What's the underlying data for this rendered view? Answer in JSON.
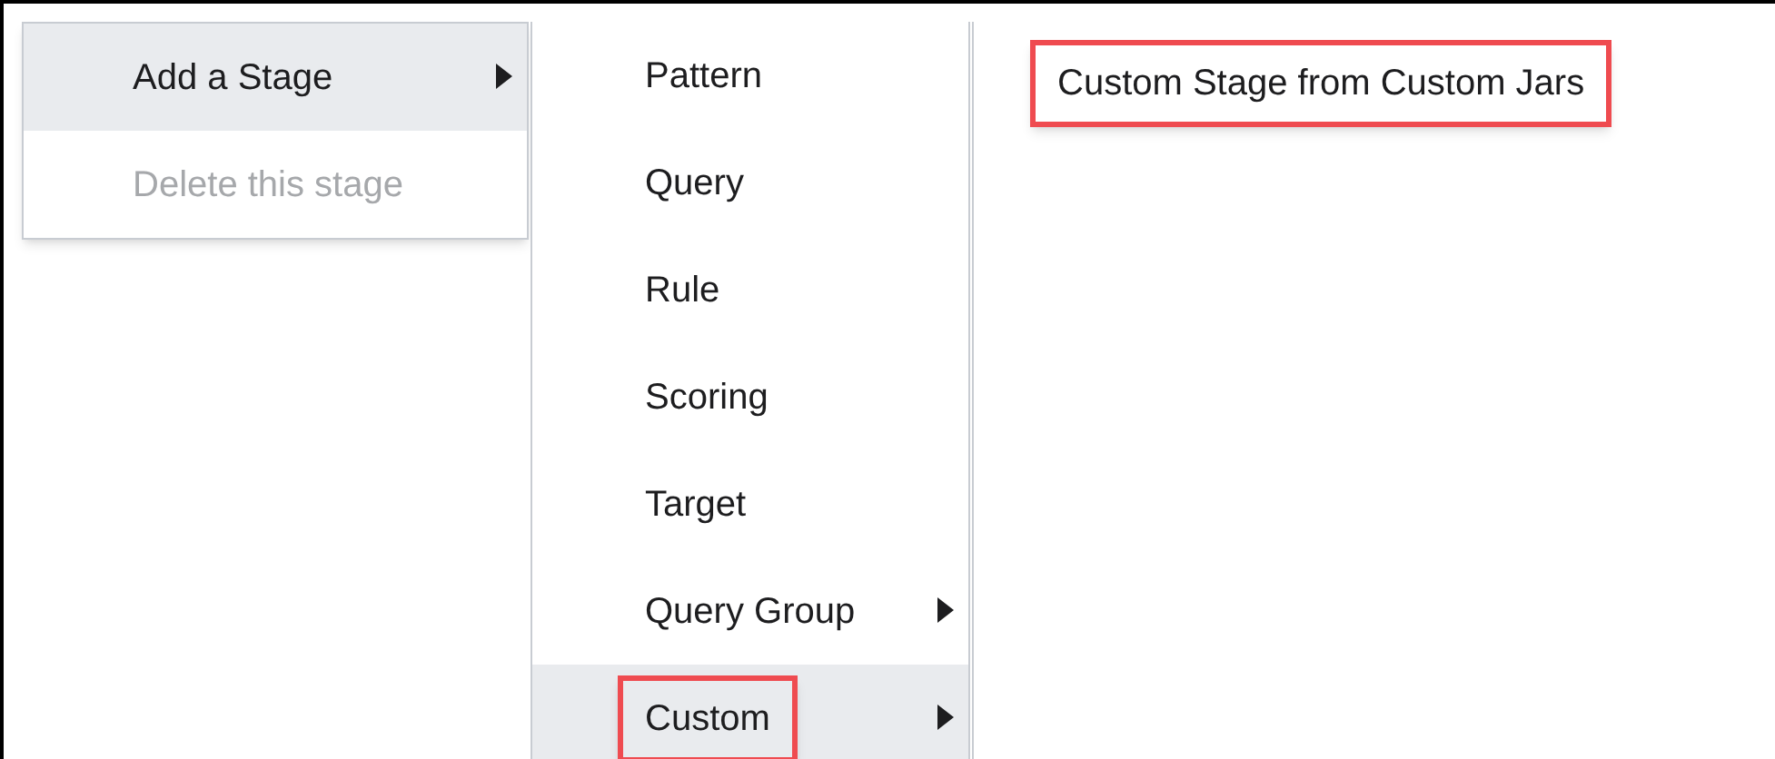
{
  "menus": [
    {
      "items": [
        {
          "label": "Add a Stage",
          "selected": true,
          "disabled": false,
          "submenu": true,
          "highlighted": false
        },
        {
          "label": "Delete this stage",
          "selected": false,
          "disabled": true,
          "submenu": false,
          "highlighted": false
        }
      ]
    },
    {
      "items": [
        {
          "label": "Pattern",
          "selected": false,
          "disabled": false,
          "submenu": false,
          "highlighted": false
        },
        {
          "label": "Query",
          "selected": false,
          "disabled": false,
          "submenu": false,
          "highlighted": false
        },
        {
          "label": "Rule",
          "selected": false,
          "disabled": false,
          "submenu": false,
          "highlighted": false
        },
        {
          "label": "Scoring",
          "selected": false,
          "disabled": false,
          "submenu": false,
          "highlighted": false
        },
        {
          "label": "Target",
          "selected": false,
          "disabled": false,
          "submenu": false,
          "highlighted": false
        },
        {
          "label": "Query Group",
          "selected": false,
          "disabled": false,
          "submenu": true,
          "highlighted": false
        },
        {
          "label": "Custom",
          "selected": true,
          "disabled": false,
          "submenu": true,
          "highlighted": true
        }
      ]
    },
    {
      "items": [
        {
          "label": "Custom Stage from Custom Jars",
          "selected": false,
          "disabled": false,
          "submenu": false,
          "highlighted": true
        }
      ]
    }
  ]
}
